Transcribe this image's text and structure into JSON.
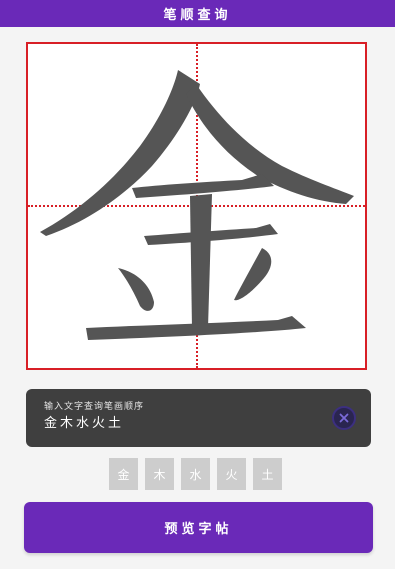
{
  "app": {
    "title": "笔顺查询"
  },
  "accent_color": "#6a29b8",
  "grid_color": "#d81f26",
  "stroke_color": "#555555",
  "canvas": {
    "character": "金"
  },
  "input": {
    "hint": "输入文字查询笔画顺序",
    "value": "金木水火土",
    "clear_icon": "close-circle-icon"
  },
  "chips": [
    "金",
    "木",
    "水",
    "火",
    "土"
  ],
  "preview_button": {
    "label": "预览字帖"
  }
}
